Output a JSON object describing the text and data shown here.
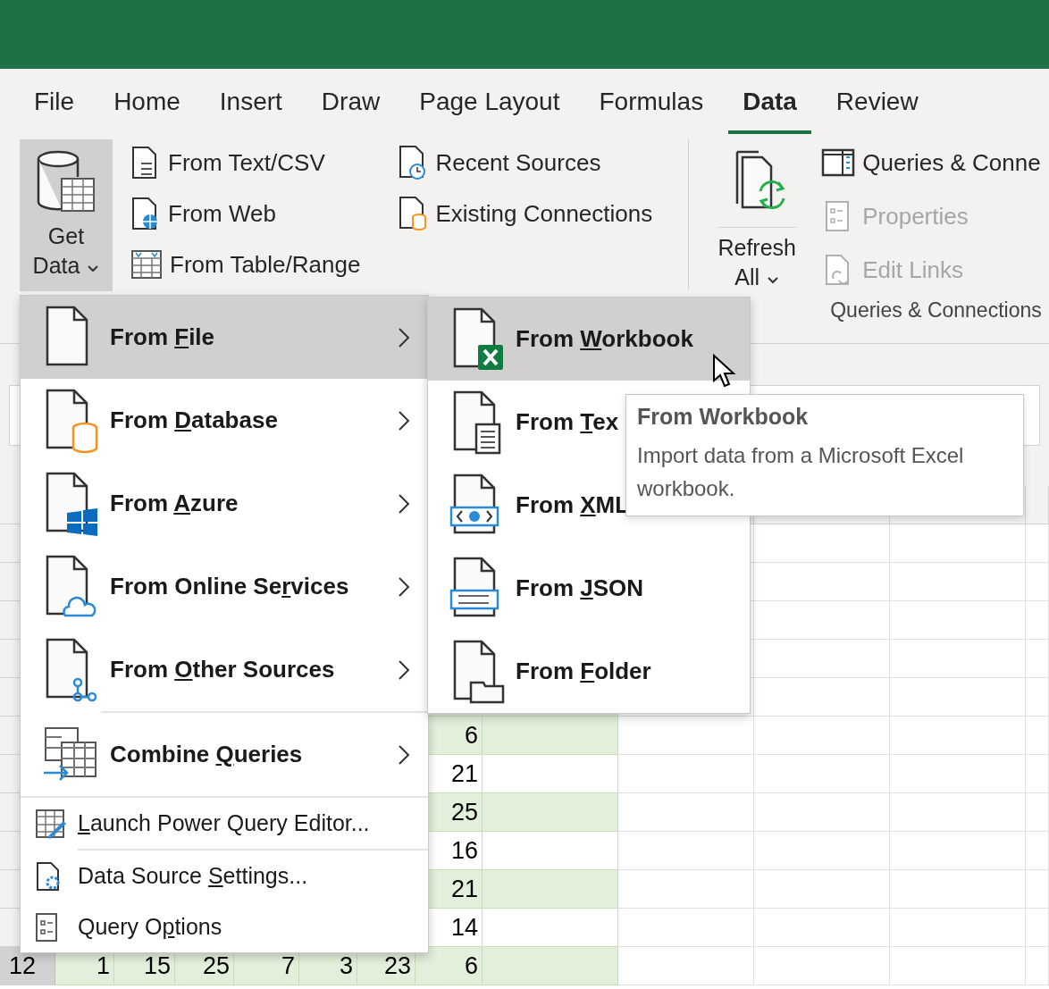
{
  "tabs": [
    {
      "label": "File",
      "selected": false
    },
    {
      "label": "Home",
      "selected": false
    },
    {
      "label": "Insert",
      "selected": false
    },
    {
      "label": "Draw",
      "selected": false
    },
    {
      "label": "Page Layout",
      "selected": false
    },
    {
      "label": "Formulas",
      "selected": false
    },
    {
      "label": "Data",
      "selected": true
    },
    {
      "label": "Review",
      "selected": false
    }
  ],
  "ribbon": {
    "get_data": {
      "line_1": "Get",
      "line_2": "Data",
      "pressed": true
    },
    "import_buttons": [
      {
        "label": "From Text/CSV"
      },
      {
        "label": "From Web"
      },
      {
        "label": "From Table/Range"
      }
    ],
    "source_buttons": [
      {
        "label": "Recent Sources"
      },
      {
        "label": "Existing Connections"
      }
    ],
    "refresh_all": {
      "line_1": "Refresh",
      "line_2": "All"
    },
    "query_buttons": [
      {
        "label": "Queries & Conne",
        "disabled": false
      },
      {
        "label": "Properties",
        "disabled": true
      },
      {
        "label": "Edit Links",
        "disabled": true
      }
    ],
    "group_label": "Queries & Connections"
  },
  "sheet": {
    "rows": [
      {
        "banded": true,
        "values": [
          "6"
        ]
      },
      {
        "banded": false,
        "values": [
          "21"
        ]
      },
      {
        "banded": true,
        "values": [
          "25"
        ]
      },
      {
        "banded": false,
        "values": [
          "16"
        ]
      },
      {
        "banded": true,
        "values": [
          "21"
        ]
      },
      {
        "banded": false,
        "values": [
          "14"
        ]
      },
      {
        "banded": true,
        "header": "12",
        "values": [
          "1",
          "15",
          "25",
          "7",
          "3",
          "23",
          "6"
        ]
      }
    ]
  },
  "get_data_menu": [
    {
      "kind": "large",
      "label": [
        "From ",
        "F",
        "ile"
      ],
      "selected": true
    },
    {
      "kind": "large",
      "label": [
        "From ",
        "D",
        "atabase"
      ],
      "selected": false
    },
    {
      "kind": "large",
      "label": [
        "From ",
        "A",
        "zure"
      ],
      "selected": false
    },
    {
      "kind": "large",
      "label": [
        "From Online Se",
        "r",
        "vices"
      ],
      "selected": false
    },
    {
      "kind": "large",
      "label": [
        "From ",
        "O",
        "ther Sources"
      ],
      "selected": false
    },
    {
      "kind": "large",
      "label": [
        "Combine ",
        "Q",
        "ueries"
      ],
      "selected": false
    },
    {
      "kind": "small",
      "label": [
        "L",
        "aunch Power Query Editor..."
      ],
      "selected": false
    },
    {
      "kind": "small",
      "label": [
        "Data Source ",
        "S",
        "ettings..."
      ],
      "selected": false
    },
    {
      "kind": "small",
      "label": [
        "Query O",
        "p",
        "tions"
      ],
      "selected": false
    }
  ],
  "from_file_menu": [
    {
      "label": [
        "From ",
        "W",
        "orkbook"
      ],
      "selected": true
    },
    {
      "label": [
        "From ",
        "T",
        "ex"
      ],
      "selected": false
    },
    {
      "label": [
        "From ",
        "X",
        "ML"
      ],
      "selected": false
    },
    {
      "label": [
        "From ",
        "J",
        "SON"
      ],
      "selected": false
    },
    {
      "label": [
        "From ",
        "F",
        "older"
      ],
      "selected": false
    }
  ],
  "tooltip": {
    "title": "From Workbook",
    "body": "Import data from a Microsoft Excel workbook."
  }
}
